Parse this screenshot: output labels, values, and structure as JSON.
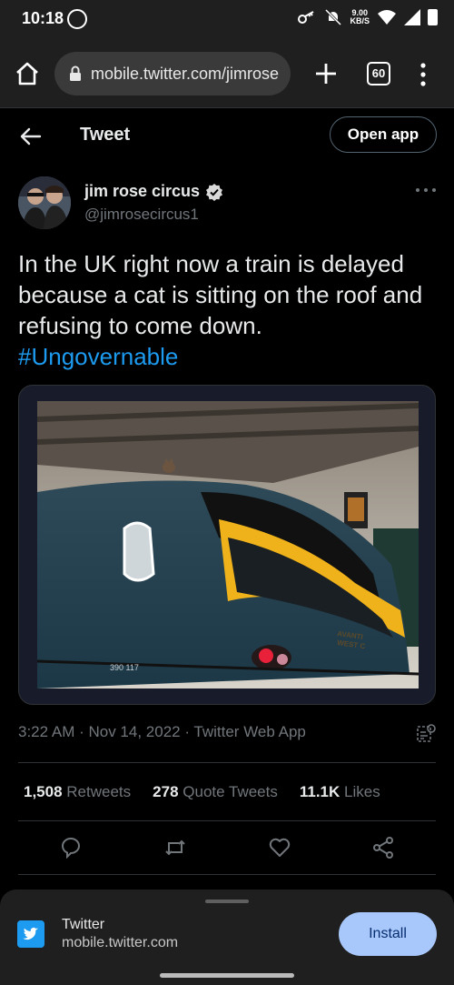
{
  "status_bar": {
    "time": "10:18",
    "speed_value": "9.00",
    "speed_unit": "KB/S"
  },
  "browser": {
    "url": "mobile.twitter.com/jimrose",
    "tab_count": "60"
  },
  "header": {
    "title": "Tweet",
    "open_app_label": "Open app"
  },
  "tweet": {
    "author_name": "jim rose circus",
    "author_handle": "@jimrosecircus1",
    "text": "In the UK right now a train is delayed because a cat is sitting on the roof and refusing to come down.",
    "hashtag": "#Ungovernable",
    "timestamp": "3:22 AM · Nov 14, 2022 · Twitter Web App",
    "image_text": {
      "brand_line1": "AVANTI",
      "brand_line2": "WEST C",
      "train_number": "390 117"
    },
    "stats": {
      "retweets_count": "1,508",
      "retweets_label": "Retweets",
      "quotes_count": "278",
      "quotes_label": "Quote Tweets",
      "likes_count": "11.1K",
      "likes_label": "Likes"
    }
  },
  "install_banner": {
    "app_name": "Twitter",
    "app_url": "mobile.twitter.com",
    "install_label": "Install"
  },
  "colors": {
    "background": "#000000",
    "accent": "#1d9bf0",
    "muted_text": "#71767b",
    "install_button": "#a8c7fa"
  }
}
